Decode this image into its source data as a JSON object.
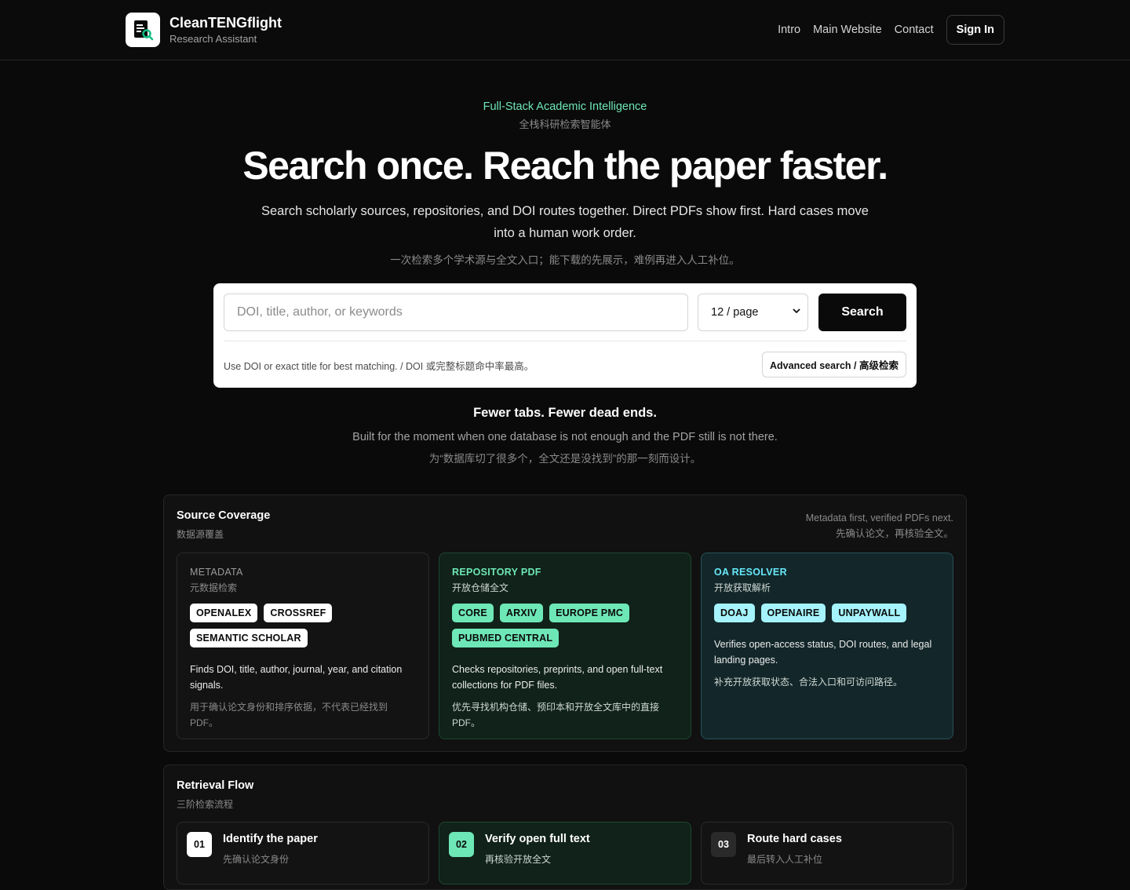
{
  "header": {
    "brand_name": "CleanTENGflight",
    "brand_sub": "Research Assistant",
    "nav": [
      "Intro",
      "Main Website",
      "Contact"
    ],
    "sign_in": "Sign In"
  },
  "hero": {
    "eyebrow": "Full-Stack Academic Intelligence",
    "eyebrow_zh": "全栈科研检索智能体",
    "headline": "Search once. Reach the paper faster.",
    "lede": "Search scholarly sources, repositories, and DOI routes together. Direct PDFs show first. Hard cases move into a human work order.",
    "lede_zh": "一次检索多个学术源与全文入口；能下载的先展示，难例再进入人工补位。"
  },
  "search": {
    "placeholder": "DOI, title, author, or keywords",
    "per_page": "12 / page",
    "button": "Search",
    "hint": "Use DOI or exact title for best matching. / DOI 或完整标题命中率最高。",
    "advanced": "Advanced search / 高级检索"
  },
  "tagline": {
    "title": "Fewer tabs. Fewer dead ends.",
    "text": "Built for the moment when one database is not enough and the PDF still is not there.",
    "text_zh": "为“数据库切了很多个，全文还是没找到”的那一刻而设计。"
  },
  "coverage": {
    "title": "Source Coverage",
    "subtitle": "数据源覆盖",
    "note_line1": "Metadata first, verified PDFs next.",
    "note_line2": "先确认论文，再核验全文。",
    "cards": [
      {
        "kicker": "METADATA",
        "kicker_zh": "元数据检索",
        "chips": [
          "OPENALEX",
          "CROSSREF",
          "SEMANTIC SCHOLAR"
        ],
        "desc": "Finds DOI, title, author, journal, year, and citation signals.",
        "desc_zh": "用于确认论文身份和排序依据，不代表已经找到 PDF。"
      },
      {
        "kicker": "REPOSITORY PDF",
        "kicker_zh": "开放仓储全文",
        "chips": [
          "CORE",
          "ARXIV",
          "EUROPE PMC",
          "PUBMED CENTRAL"
        ],
        "desc": "Checks repositories, preprints, and open full-text collections for PDF files.",
        "desc_zh": "优先寻找机构仓储、预印本和开放全文库中的直接 PDF。"
      },
      {
        "kicker": "OA RESOLVER",
        "kicker_zh": "开放获取解析",
        "chips": [
          "DOAJ",
          "OPENAIRE",
          "UNPAYWALL"
        ],
        "desc": "Verifies open-access status, DOI routes, and legal landing pages.",
        "desc_zh": "补充开放获取状态、合法入口和可访问路径。"
      }
    ]
  },
  "flow": {
    "title": "Retrieval Flow",
    "subtitle": "三阶检索流程",
    "steps": [
      {
        "num": "01",
        "title": "Identify the paper",
        "sub": "先确认论文身份"
      },
      {
        "num": "02",
        "title": "Verify open full text",
        "sub": "再核验开放全文"
      },
      {
        "num": "03",
        "title": "Route hard cases",
        "sub": "最后转入人工补位"
      }
    ]
  },
  "colors": {
    "background": "#0a0a0a",
    "accent_green": "#6ee7b7",
    "accent_cyan": "#a5f3fc"
  }
}
